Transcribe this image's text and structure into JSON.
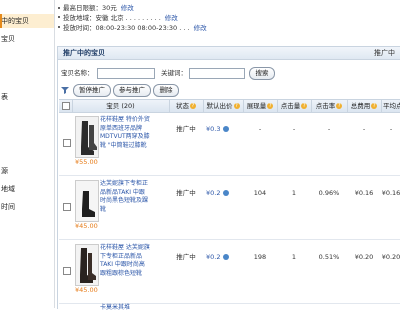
{
  "sidebar": {
    "items": [
      {
        "label": "中的宝贝",
        "active": true
      },
      {
        "label": "宝贝",
        "active": false
      },
      {
        "label": "表",
        "active": false
      },
      {
        "label": "源",
        "active": false
      },
      {
        "label": "地域",
        "active": false
      },
      {
        "label": "时间",
        "active": false
      }
    ]
  },
  "info": {
    "lines": [
      {
        "label": "最高日限额：30元",
        "link": "修改"
      },
      {
        "label": "投放地域：安徽 北京 . . . . . . . . .",
        "link": "修改"
      },
      {
        "label": "投放时间：08:00-23:30 08:00-23:30 . . .",
        "link": "修改"
      }
    ]
  },
  "panel": {
    "title": "推广中的宝贝",
    "right_text": "推广中"
  },
  "search": {
    "name_label": "宝贝名称：",
    "keyword_label": "关键词：",
    "button": "搜索"
  },
  "toolbar": {
    "pause": "暂停推广",
    "join": "参与推广",
    "delete": "删除"
  },
  "table": {
    "headers": {
      "item": "宝贝 (20)",
      "status": "状态",
      "default_bid": "默认出价",
      "impressions": "展现量",
      "clicks": "点击量",
      "ctr": "点击率",
      "cost": "总费用",
      "avg": "平均点"
    },
    "rows": [
      {
        "title": "花样鞋屋 特价外贸原单西班牙品牌 MDTVUT两穿及膝靴 \"中筒鞋过膝靴",
        "price": "¥55.00",
        "status": "推广中",
        "bid": "¥0.3",
        "impressions": "-",
        "clicks": "-",
        "ctr": "-",
        "cost": "-",
        "avg": "-"
      },
      {
        "title": "达芙妮旗下专柜正品新品TAKI 中跟时尚黑色短靴及踝靴",
        "price": "¥45.00",
        "status": "推广中",
        "bid": "¥0.2",
        "impressions": "104",
        "clicks": "1",
        "ctr": "0.96%",
        "cost": "¥0.16",
        "avg": "¥0.16"
      },
      {
        "title": "花样鞋屋 达芙妮旗下专柜正品新品TAKI 中跟时尚高跟粗跟棕色短靴",
        "price": "¥45.00",
        "status": "推广中",
        "bid": "¥0.2",
        "impressions": "198",
        "clicks": "1",
        "ctr": "0.51%",
        "cost": "¥0.20",
        "avg": "¥0.20"
      },
      {
        "title": "卡莫米其堆",
        "price": "",
        "status": "",
        "bid": "",
        "impressions": "",
        "clicks": "",
        "ctr": "",
        "cost": "",
        "avg": ""
      }
    ]
  },
  "colors": {
    "accent": "#e58a1c",
    "link": "#2a55a8",
    "price": "#e67a16"
  }
}
